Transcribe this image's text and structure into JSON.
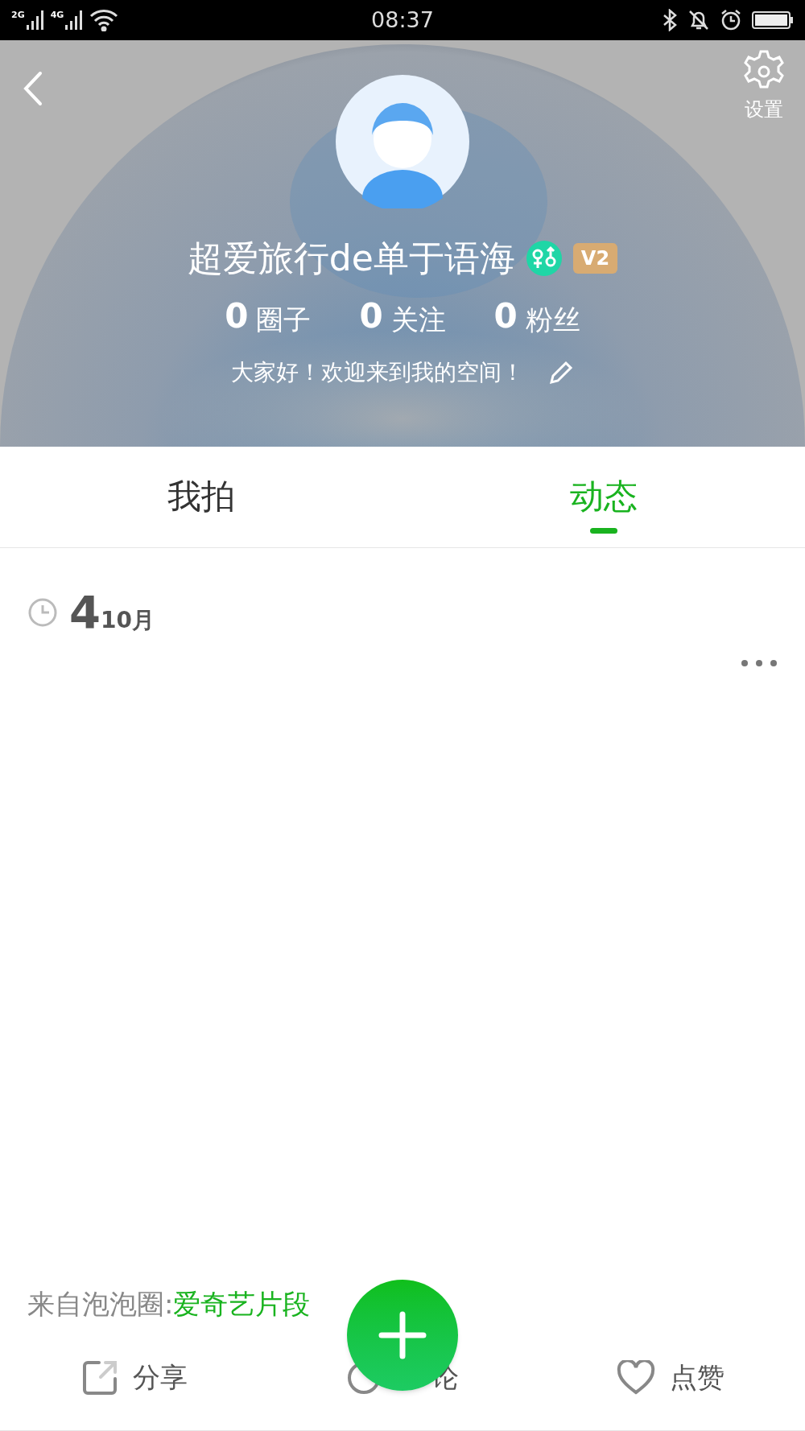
{
  "status_bar": {
    "signal_labels": [
      "2G",
      "4G"
    ],
    "time": "08:37"
  },
  "header": {
    "settings_label": "设置",
    "username": "超爱旅行de单于语海",
    "level_badge": "V2",
    "stats": [
      {
        "count": "0",
        "label": "圈子"
      },
      {
        "count": "0",
        "label": "关注"
      },
      {
        "count": "0",
        "label": "粉丝"
      }
    ],
    "bio": "大家好！欢迎来到我的空间！"
  },
  "tabs": [
    {
      "label": "我拍",
      "selected": false
    },
    {
      "label": "动态",
      "selected": true
    }
  ],
  "post": {
    "day": "4",
    "month": "10月",
    "source_prefix": "来自泡泡圈:",
    "source_link": "爱奇艺片段"
  },
  "actions": [
    {
      "kind": "share",
      "label": "分享"
    },
    {
      "kind": "comment",
      "label": "论"
    },
    {
      "kind": "like",
      "label": "点赞"
    }
  ]
}
